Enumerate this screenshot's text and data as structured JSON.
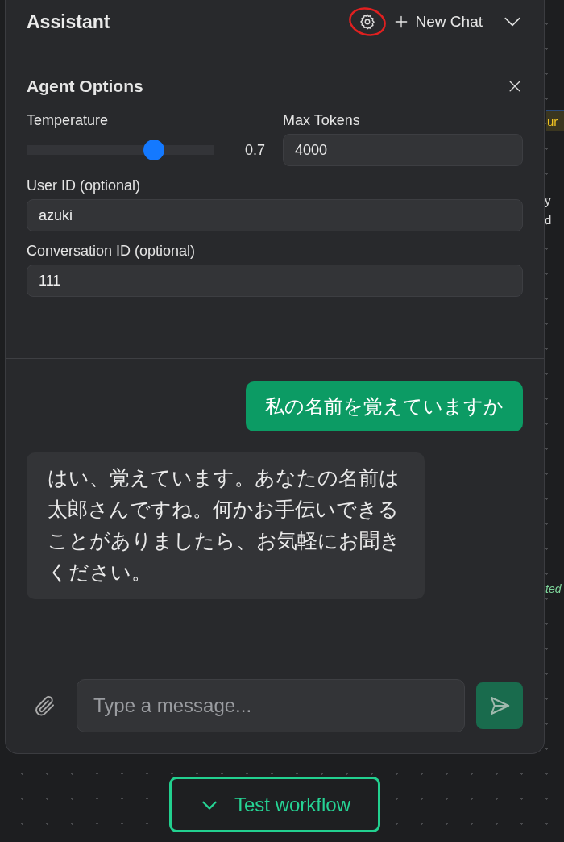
{
  "background": {
    "fragments": [
      {
        "text": "ur",
        "kind": "tag"
      },
      {
        "text": "y",
        "kind": "plain"
      },
      {
        "text": "d",
        "kind": "plain"
      },
      {
        "text": "ted",
        "kind": "status"
      }
    ]
  },
  "panel": {
    "title": "Assistant",
    "settings_highlighted": true,
    "new_chat": "New Chat"
  },
  "options": {
    "title": "Agent Options",
    "temperature": {
      "label": "Temperature",
      "level": 0.68,
      "reading": "0.7"
    },
    "max_tokens": {
      "label": "Max Tokens",
      "value": "4000"
    },
    "user_id": {
      "label": "User ID (optional)",
      "value": "azuki"
    },
    "conversation_id": {
      "label": "Conversation ID (optional)",
      "value": "111"
    }
  },
  "messages": [
    {
      "kind": "sent",
      "text": "私の名前を覚えていますか"
    },
    {
      "kind": "received",
      "text": "はい、覚えています。あなたの名前は太郎さんですね。何かお手伝いできることがありましたら、お気軽にお聞きください。"
    }
  ],
  "composer": {
    "placeholder": "Type a message..."
  },
  "test_button": {
    "label": "Test workflow"
  }
}
